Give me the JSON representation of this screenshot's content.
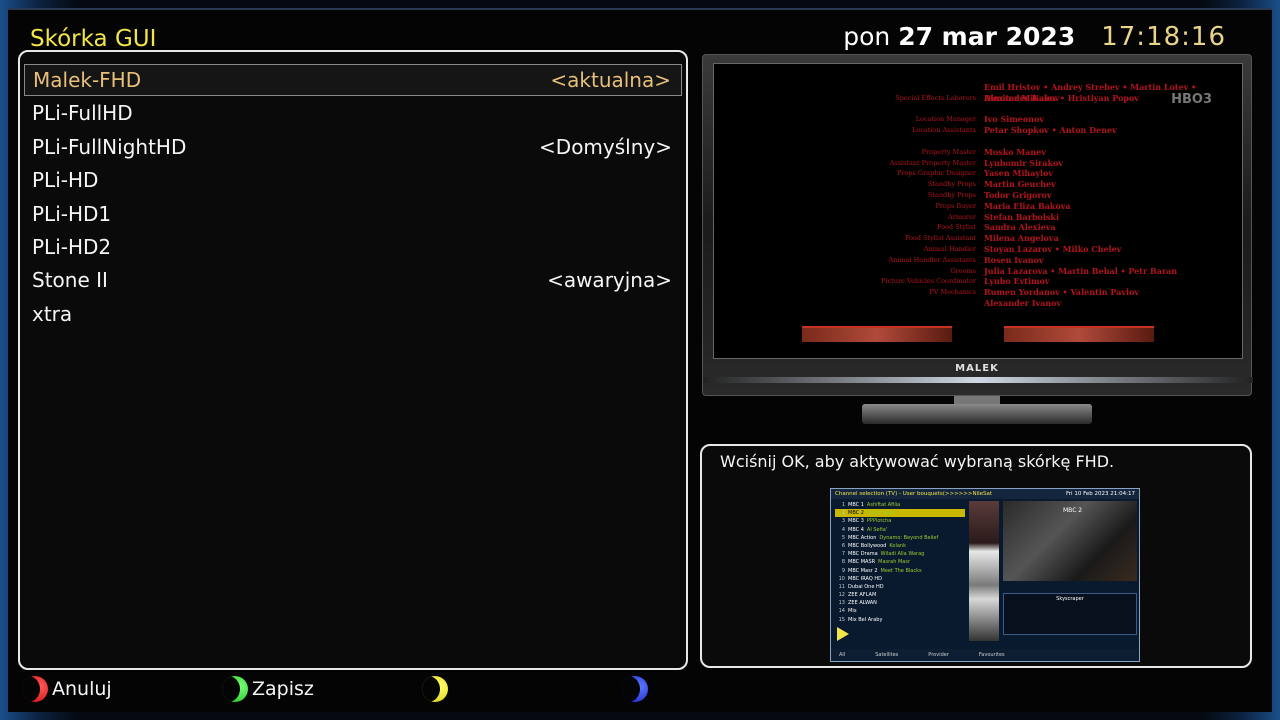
{
  "header": {
    "title": "Skórka GUI",
    "date_prefix": "pon",
    "date_main": "27 mar 2023",
    "time": "17:18:16"
  },
  "skins": [
    {
      "name": "Malek-FHD",
      "tag": "<aktualna>",
      "selected": true
    },
    {
      "name": "PLi-FullHD",
      "tag": ""
    },
    {
      "name": "PLi-FullNightHD",
      "tag": "<Domyślny>"
    },
    {
      "name": "PLi-HD",
      "tag": ""
    },
    {
      "name": "PLi-HD1",
      "tag": ""
    },
    {
      "name": "PLi-HD2",
      "tag": ""
    },
    {
      "name": "Stone II",
      "tag": "<awaryjna>"
    },
    {
      "name": "xtra",
      "tag": ""
    }
  ],
  "preview": {
    "brand": "MALEK",
    "channel_logo": "HBO3",
    "credits": [
      {
        "role": "",
        "names": "Emil Hristov • Andrey Strebev • Martin Lotev • Alexander Kakov"
      },
      {
        "role": "Special Effects Laborers",
        "names": "Dimitar Mihalev • Hristiyan Popov"
      },
      {
        "role": "",
        "names": ""
      },
      {
        "role": "Location Manager",
        "names": "Ivo Simeonov"
      },
      {
        "role": "Location Assistants",
        "names": "Petar Shopkov • Anton Denev"
      },
      {
        "role": "",
        "names": ""
      },
      {
        "role": "Property Master",
        "names": "Mosko Manev"
      },
      {
        "role": "Assistant Property Master",
        "names": "Lyubomir Sirakov"
      },
      {
        "role": "Props Graphic Designer",
        "names": "Yasen Mihaylov"
      },
      {
        "role": "Standby Props",
        "names": "Martin Geuchev"
      },
      {
        "role": "Standby Props",
        "names": "Todor Grigorov"
      },
      {
        "role": "Props Buyer",
        "names": "Maria Eliza Bakova"
      },
      {
        "role": "Armorer",
        "names": "Stefan Barbolski"
      },
      {
        "role": "Food Stylist",
        "names": "Sandra Alexieva"
      },
      {
        "role": "Food Stylist Assistant",
        "names": "Milena Angelova"
      },
      {
        "role": "Animal Handler",
        "names": "Stoyan Lazarov • Milko Chelev"
      },
      {
        "role": "Animal Handler Assistants",
        "names": "Rosen Ivanov"
      },
      {
        "role": "Grooms",
        "names": "Julia Lazarova • Martin Behal • Petr Baran"
      },
      {
        "role": "Picture Vehicles Coordinator",
        "names": "Lyubo Evtimov"
      },
      {
        "role": "PV Mechanics",
        "names": "Rumen Yordanov • Valentin Pavlov"
      },
      {
        "role": "",
        "names": "Alexander Ivanov"
      }
    ]
  },
  "info": {
    "message": "Wciśnij OK, aby aktywować wybraną skórkę FHD.",
    "mini": {
      "header_left": "Channel selection (TV) - User bouquets(>>>>>>NileSat",
      "header_right": "Fri 10 Feb 2023   21:04:17",
      "video_label": "MBC 2",
      "epg_title": "Skyscraper",
      "channels": [
        {
          "n": "1",
          "name": "MBC 1",
          "ep": "Ashiftat Afilia"
        },
        {
          "n": "2",
          "name": "MBC 2",
          "ep": "Skyscraper",
          "sel": true
        },
        {
          "n": "3",
          "name": "MBC 3",
          "ep": "PPPlotcha"
        },
        {
          "n": "4",
          "name": "MBC 4",
          "ep": "Al Sefia'"
        },
        {
          "n": "5",
          "name": "MBC Action",
          "ep": "Dynamo: Beyond Belief"
        },
        {
          "n": "6",
          "name": "MBC Bollywood",
          "ep": "Kolank"
        },
        {
          "n": "7",
          "name": "MBC Drama",
          "ep": "Wiladi Alla Warag"
        },
        {
          "n": "8",
          "name": "MBC MASR",
          "ep": "Masrah Masr"
        },
        {
          "n": "9",
          "name": "MBC Masr 2",
          "ep": "Meet The Blacks"
        },
        {
          "n": "10",
          "name": "MBC IRAQ HD",
          "ep": ""
        },
        {
          "n": "11",
          "name": "Dubai One HD",
          "ep": ""
        },
        {
          "n": "12",
          "name": "ZEE AFLAM",
          "ep": ""
        },
        {
          "n": "13",
          "name": "ZEE ALWAN",
          "ep": ""
        },
        {
          "n": "14",
          "name": "Mix",
          "ep": ""
        },
        {
          "n": "15",
          "name": "Mix Bel Araby",
          "ep": ""
        }
      ],
      "foot": [
        "All",
        "Satellites",
        "Provider",
        "Favourites"
      ]
    }
  },
  "buttons": {
    "red": "Anuluj",
    "green": "Zapisz",
    "yellow": "",
    "blue": ""
  },
  "colors": {
    "title": "#f2e54a",
    "selected": "#e6c07a",
    "red": "#c10000",
    "green": "#10b810",
    "yellow": "#d8c400",
    "blue": "#1414c8"
  }
}
